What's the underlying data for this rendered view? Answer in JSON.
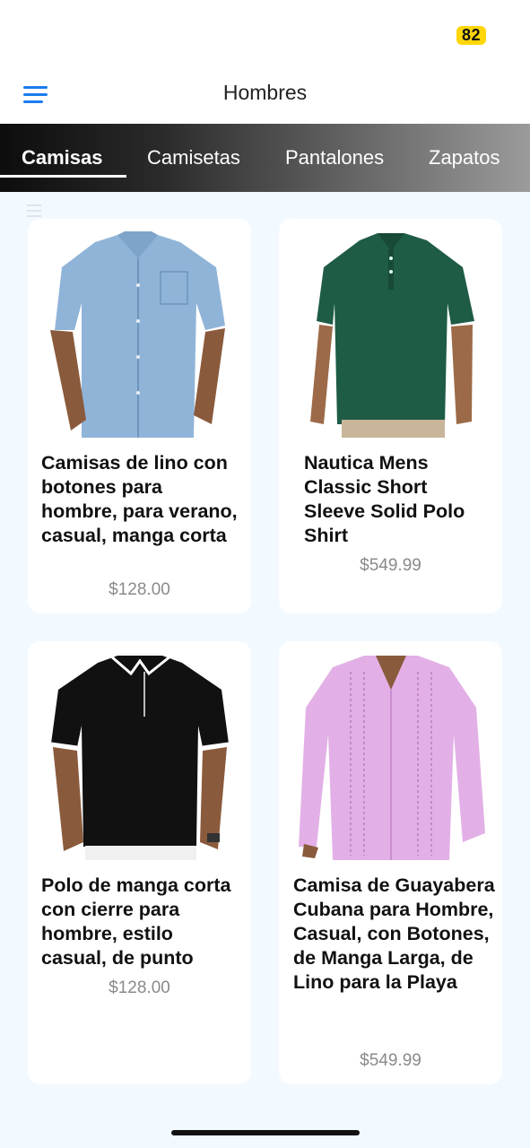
{
  "status": {
    "battery": "82",
    "battery_color": "#ffd60a"
  },
  "header": {
    "title": "Hombres",
    "menu_icon": "hamburger-menu-icon",
    "accent": "#1a7cf0"
  },
  "tabs": [
    {
      "label": "Camisas",
      "active": true
    },
    {
      "label": "Camisetas",
      "active": false
    },
    {
      "label": "Pantalones",
      "active": false
    },
    {
      "label": "Zapatos",
      "active": false
    }
  ],
  "products": [
    {
      "title": "Camisas de lino con botones para hombre, para verano, casual, manga corta",
      "price": "$128.00",
      "image": "light-blue-linen-shirt-photo"
    },
    {
      "title": "Nautica Mens Classic Short Sleeve Solid Polo Shirt",
      "price": "$549.99",
      "image": "green-polo-shirt-photo"
    },
    {
      "title": "Polo de manga corta con cierre para hombre, estilo casual, de punto",
      "price": "$128.00",
      "image": "black-zip-polo-photo"
    },
    {
      "title": "Camisa de Guayabera Cubana para Hombre, Casual, con Botones, de Manga Larga, de Lino para la Playa",
      "price": "$549.99",
      "image": "pink-guayabera-shirt-photo"
    }
  ]
}
